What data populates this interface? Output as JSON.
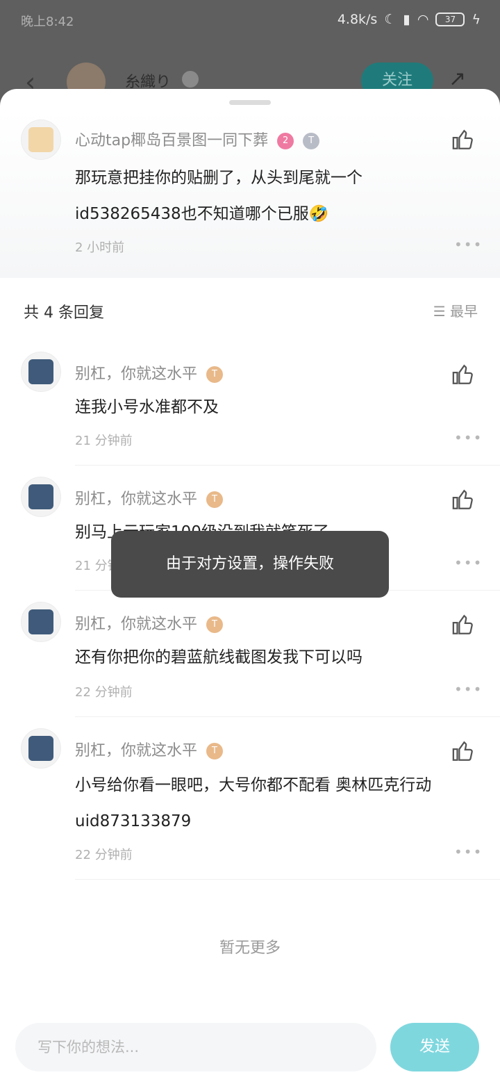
{
  "status_bar": {
    "time": "晚上8:42",
    "network_speed": "4.8k/s",
    "battery": "37"
  },
  "background_header": {
    "name": "糸織り",
    "follow_label": "关注"
  },
  "main_comment": {
    "username": "心动tap椰岛百景图一同下葬",
    "badge_number": "2",
    "content_lines": [
      "那玩意把挂你的贴删了，从头到尾就一个",
      "id538265438也不知道哪个已服🤣"
    ],
    "time": "2 小时前"
  },
  "replies_header": {
    "count_label": "共 4 条回复",
    "sort_label": "最早"
  },
  "replies": [
    {
      "username": "别杠，你就这水平",
      "content_lines": [
        "连我小号水准都不及"
      ],
      "time": "21 分钟前"
    },
    {
      "username": "别杠，你就这水平",
      "content_lines": [
        "别马上云玩家100级没到我就笑死了"
      ],
      "time": "21 分钟前"
    },
    {
      "username": "别杠，你就这水平",
      "content_lines": [
        "还有你把你的碧蓝航线截图发我下可以吗"
      ],
      "time": "22 分钟前"
    },
    {
      "username": "别杠，你就这水平",
      "content_lines": [
        "小号给你看一眼吧，大号你都不配看 奥林匹克行动",
        "uid873133879"
      ],
      "time": "22 分钟前"
    }
  ],
  "no_more": "暂无更多",
  "toast": "由于对方设置，操作失败",
  "composer": {
    "placeholder": "写下你的想法...",
    "send_label": "发送"
  },
  "colors": {
    "accent": "#7fd7de",
    "follow_button": "#1f7b7b",
    "toast_bg": "#4a4a4a"
  }
}
